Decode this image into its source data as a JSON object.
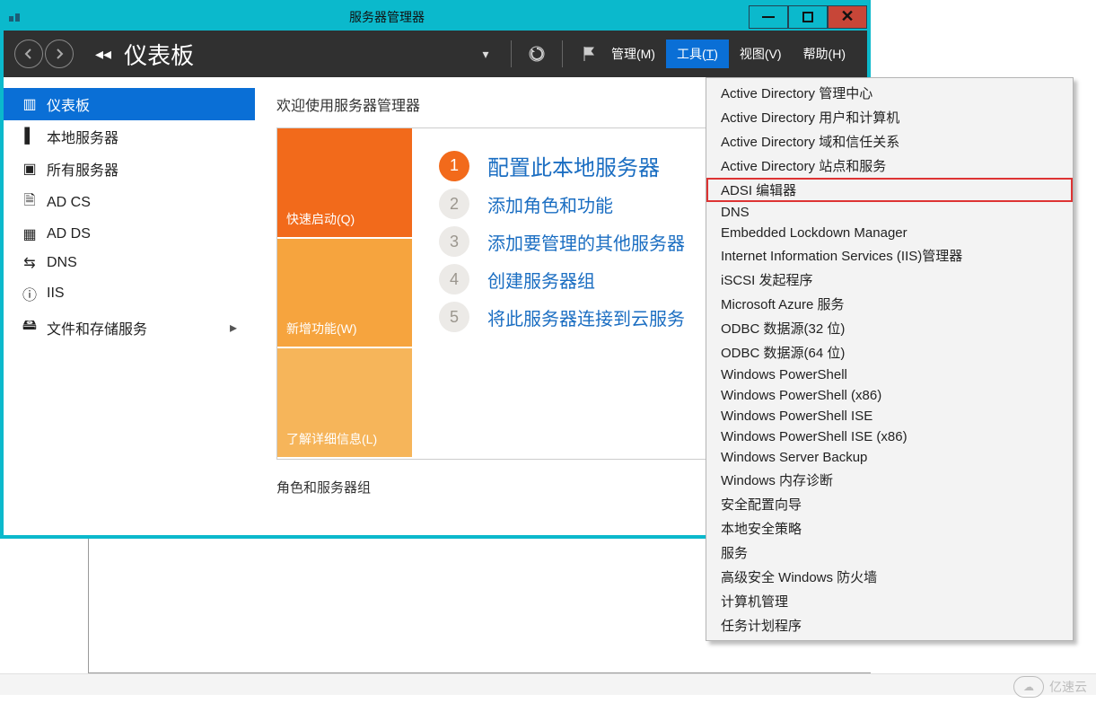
{
  "window": {
    "title": "服务器管理器",
    "min_label": "_",
    "max_label": "□",
    "close_label": "×"
  },
  "header": {
    "crumb_sep": "◂◂",
    "crumb_title": "仪表板",
    "dropdown_glyph": "▾",
    "refresh_glyph": "⟳",
    "flag_glyph": "⚑"
  },
  "menubar": {
    "items": [
      {
        "label": "管理(M)",
        "active": false
      },
      {
        "label": "工具(T)",
        "active": true
      },
      {
        "label": "视图(V)",
        "active": false
      },
      {
        "label": "帮助(H)",
        "active": false
      }
    ]
  },
  "sidebar": {
    "items": [
      {
        "icon": "grid",
        "label": "仪表板",
        "active": true
      },
      {
        "icon": "server",
        "label": "本地服务器",
        "active": false
      },
      {
        "icon": "servers",
        "label": "所有服务器",
        "active": false
      },
      {
        "icon": "cert",
        "label": "AD CS",
        "active": false
      },
      {
        "icon": "ad",
        "label": "AD DS",
        "active": false
      },
      {
        "icon": "dns",
        "label": "DNS",
        "active": false
      },
      {
        "icon": "iis",
        "label": "IIS",
        "active": false
      },
      {
        "icon": "disk",
        "label": "文件和存储服务",
        "active": false,
        "has_children": true
      }
    ]
  },
  "content": {
    "welcome_title": "欢迎使用服务器管理器",
    "tiles": {
      "quickstart_label": "快速启动(Q)",
      "whatsnew_label": "新增功能(W)",
      "learnmore_label": "了解详细信息(L)"
    },
    "config_items": [
      {
        "num": "1",
        "label": "配置此本地服务器"
      },
      {
        "num": "2",
        "label": "添加角色和功能"
      },
      {
        "num": "3",
        "label": "添加要管理的其他服务器"
      },
      {
        "num": "4",
        "label": "创建服务器组"
      },
      {
        "num": "5",
        "label": "将此服务器连接到云服务"
      }
    ],
    "roles_section_title": "角色和服务器组"
  },
  "tools_menu": {
    "items": [
      "Active Directory 管理中心",
      "Active Directory 用户和计算机",
      "Active Directory 域和信任关系",
      "Active Directory 站点和服务",
      "ADSI 编辑器",
      "DNS",
      "Embedded Lockdown Manager",
      "Internet Information Services (IIS)管理器",
      "iSCSI 发起程序",
      "Microsoft Azure 服务",
      "ODBC 数据源(32 位)",
      "ODBC 数据源(64 位)",
      "Windows PowerShell",
      "Windows PowerShell (x86)",
      "Windows PowerShell ISE",
      "Windows PowerShell ISE (x86)",
      "Windows Server Backup",
      "Windows 内存诊断",
      "安全配置向导",
      "本地安全策略",
      "服务",
      "高级安全 Windows 防火墙",
      "计算机管理",
      "任务计划程序"
    ],
    "highlight_index": 4
  },
  "watermark": {
    "text": "亿速云"
  },
  "icon_glyph": {
    "grid": "▥",
    "server": "▌",
    "servers": "▣",
    "cert": "🗎",
    "ad": "▦",
    "dns": "⇆",
    "iis": "ⓘ",
    "disk": "🖴"
  }
}
